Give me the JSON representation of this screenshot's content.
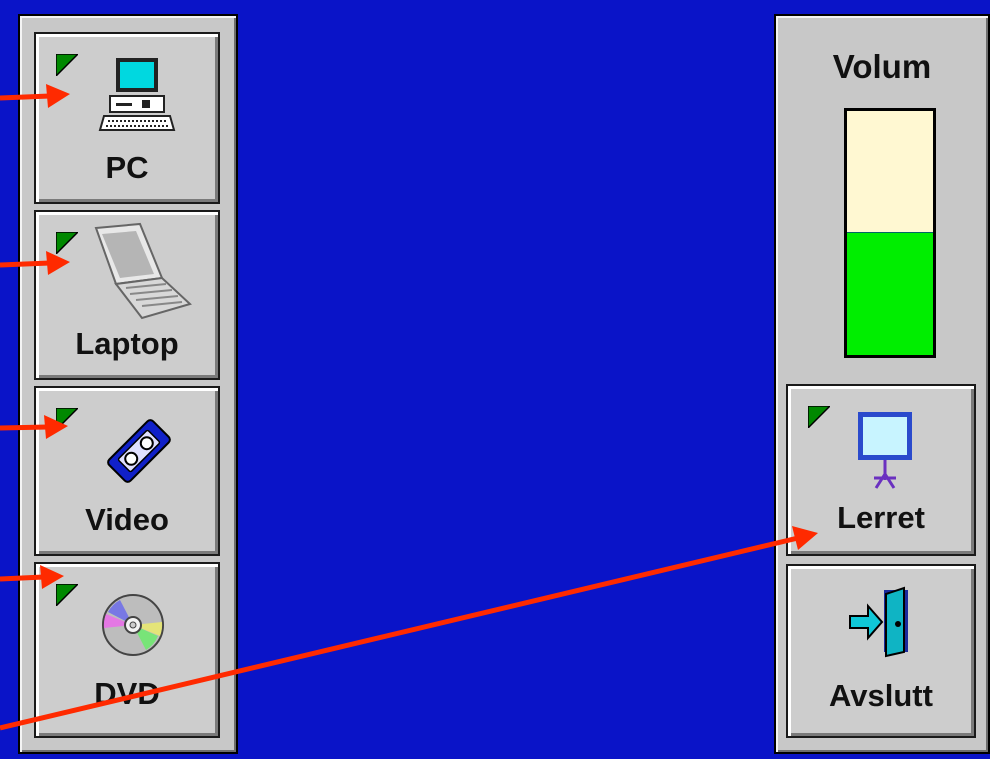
{
  "left_panel": {
    "buttons": [
      {
        "label": "PC",
        "icon": "desktop-computer-icon"
      },
      {
        "label": "Laptop",
        "icon": "laptop-icon"
      },
      {
        "label": "Video",
        "icon": "videocassette-icon"
      },
      {
        "label": "DVD",
        "icon": "dvd-disc-icon"
      }
    ]
  },
  "right_panel": {
    "volume": {
      "title": "Volum",
      "level": 0.5
    },
    "buttons": [
      {
        "label": "Lerret",
        "icon": "projection-screen-icon"
      },
      {
        "label": "Avslutt",
        "icon": "exit-door-icon"
      }
    ]
  },
  "colors": {
    "background": "#0a14c8",
    "panel": "#c8c8c8",
    "indicator": "#008800",
    "volume_fill": "#00ee00",
    "volume_empty": "#fff8d2",
    "annotation_arrow": "#ff2a00"
  }
}
